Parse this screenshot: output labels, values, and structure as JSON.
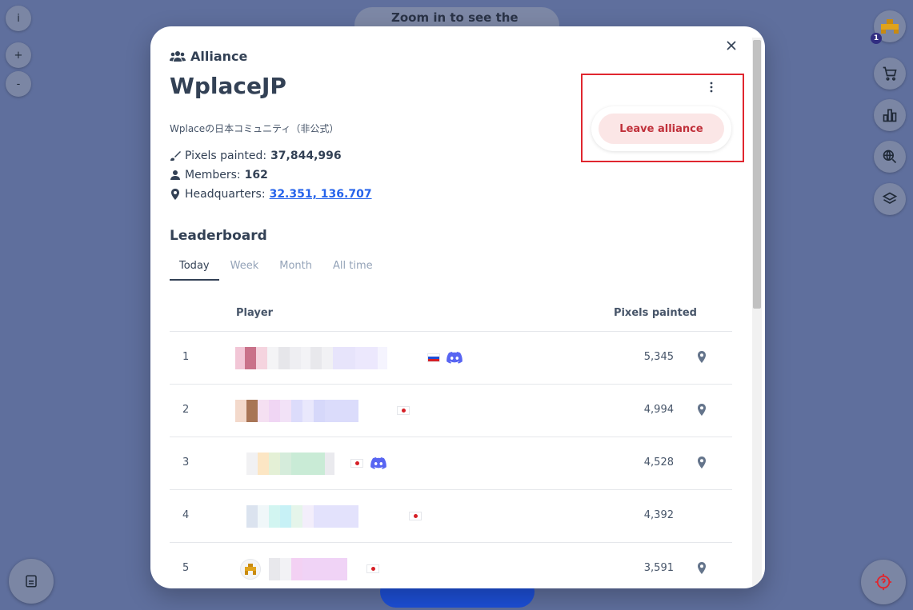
{
  "map": {
    "zoom_hint": "Zoom in to see the pixels",
    "info_label": "i",
    "zoom_in_label": "+",
    "zoom_out_label": "-",
    "notification_count": "1"
  },
  "modal": {
    "kicker": "Alliance",
    "name": "WplaceJP",
    "description": "Wplaceの日本コミュニティ（非公式）",
    "stats": {
      "pixels_label": "Pixels painted:",
      "pixels_value": "37,844,996",
      "members_label": "Members:",
      "members_value": "162",
      "hq_label": "Headquarters:",
      "hq_value": "32.351, 136.707"
    },
    "leave_label": "Leave alliance",
    "leaderboard": {
      "title": "Leaderboard",
      "tabs": [
        "Today",
        "Week",
        "Month",
        "All time"
      ],
      "active_tab": "Today",
      "columns": {
        "player": "Player",
        "pixels": "Pixels painted"
      },
      "rows": [
        {
          "rank": "1",
          "pixels": "5,345",
          "flag": "ru",
          "discord": true
        },
        {
          "rank": "2",
          "pixels": "4,994",
          "flag": "jp",
          "discord": false
        },
        {
          "rank": "3",
          "pixels": "4,528",
          "flag": "jp",
          "discord": true
        },
        {
          "rank": "4",
          "pixels": "4,392",
          "flag": "jp",
          "discord": false
        },
        {
          "rank": "5",
          "pixels": "3,591",
          "flag": "jp",
          "discord": false
        }
      ]
    }
  },
  "colors": {
    "accent": "#2563eb",
    "danger": "#c0303a",
    "danger_bg": "#fbe6e6",
    "highlight_box": "#e0262f",
    "discord": "#5865f2"
  }
}
